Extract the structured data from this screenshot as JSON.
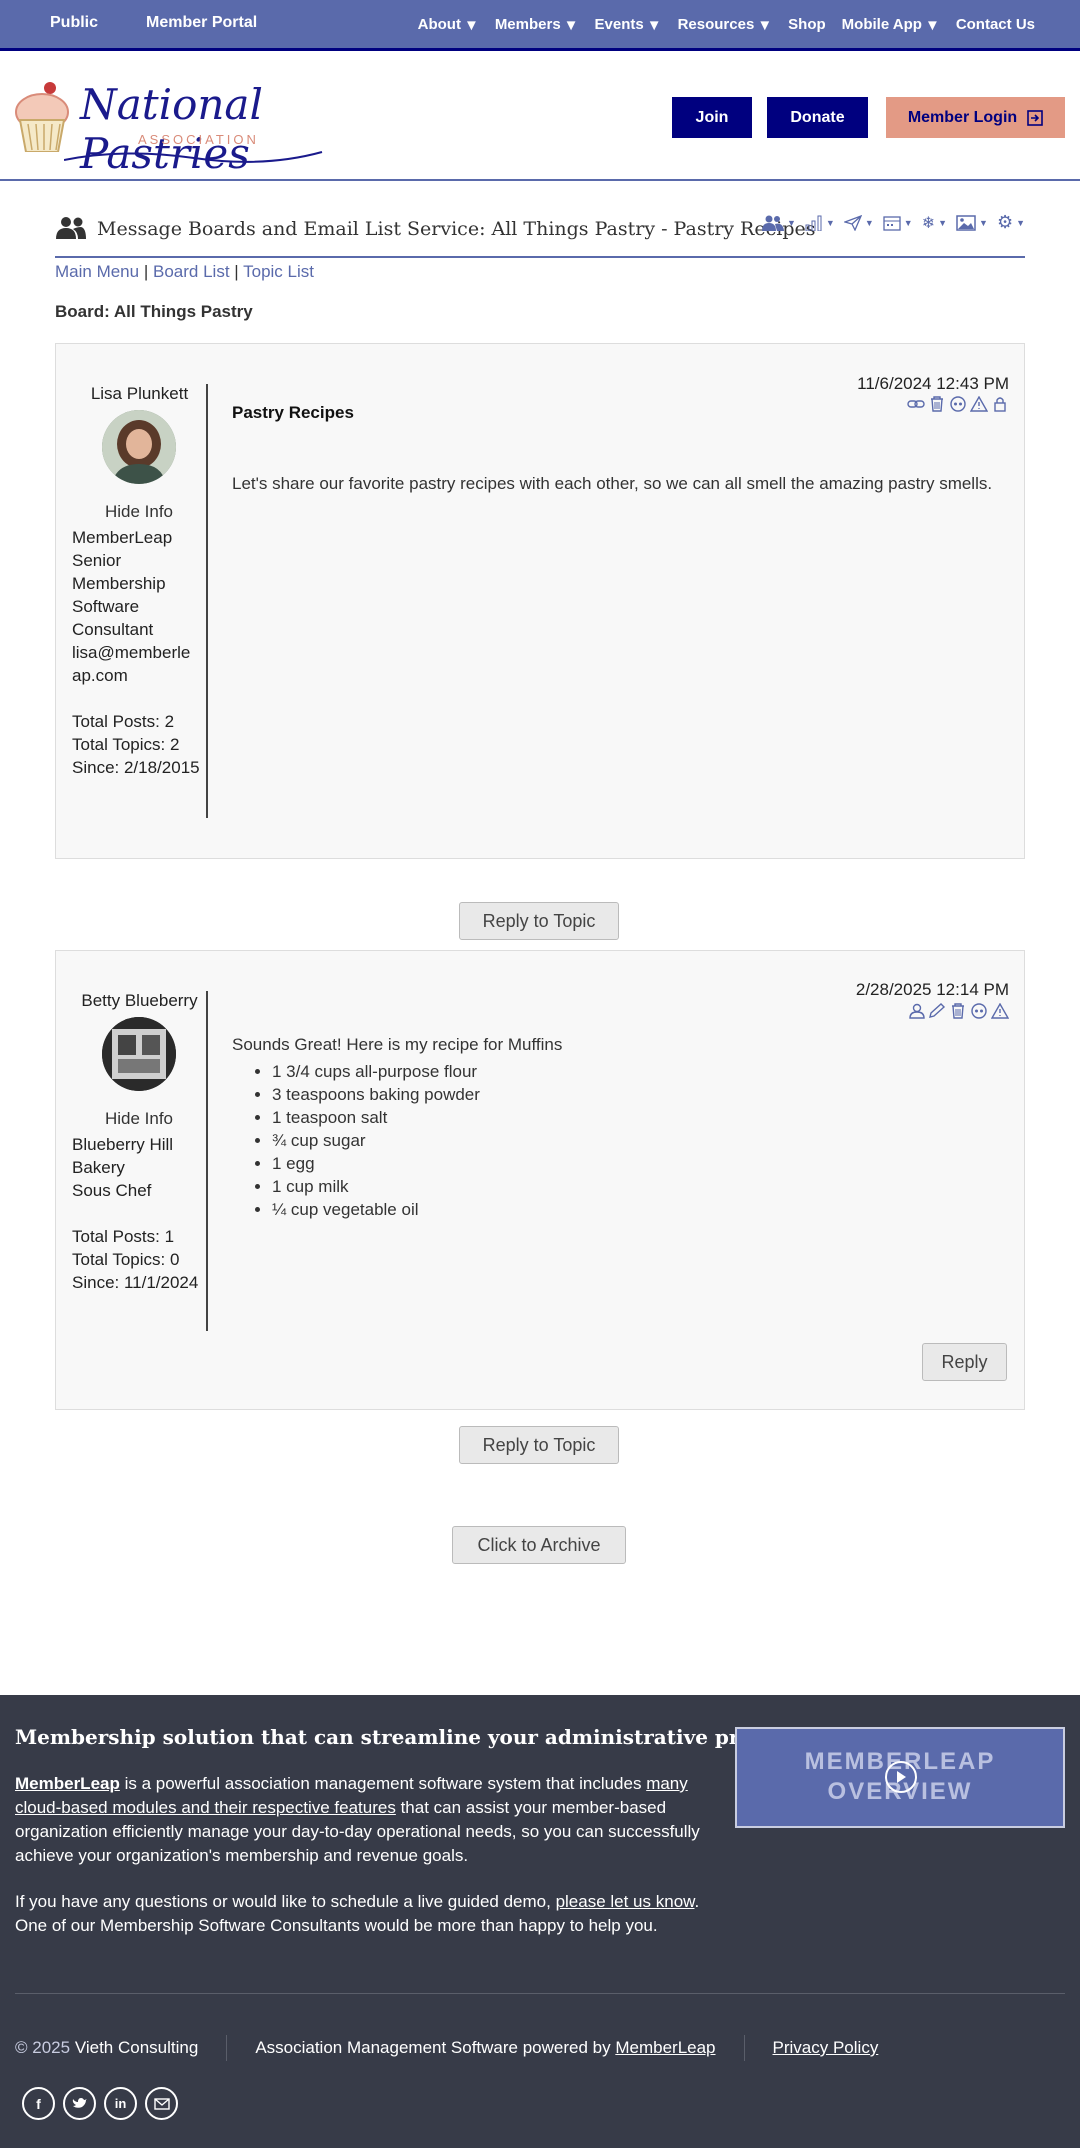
{
  "topnav": {
    "left": [
      "Public",
      "Member Portal"
    ],
    "right": [
      {
        "label": "About",
        "dropdown": true
      },
      {
        "label": "Members",
        "dropdown": true
      },
      {
        "label": "Events",
        "dropdown": true
      },
      {
        "label": "Resources",
        "dropdown": true
      },
      {
        "label": "Shop",
        "dropdown": false
      },
      {
        "label": "Mobile App",
        "dropdown": true
      },
      {
        "label": "Contact Us",
        "dropdown": false
      }
    ]
  },
  "header": {
    "logo_line1": "National Pastries",
    "logo_line2": "ASSOCIATION",
    "join": "Join",
    "donate": "Donate",
    "login": "Member Login"
  },
  "board": {
    "title": "Message Boards and Email List Service: All Things Pastry - Pastry Recipes",
    "breadcrumbs": [
      "Main Menu",
      "Board List",
      "Topic List"
    ],
    "board_label": "Board: All Things Pastry"
  },
  "posts": [
    {
      "author": "Lisa Plunkett",
      "hide_info": "Hide Info",
      "info": [
        "MemberLeap",
        "Senior",
        "Membership",
        "Software",
        "Consultant",
        "lisa@memberle",
        "ap.com"
      ],
      "stats": [
        "Total Posts: 2",
        "Total Topics: 2",
        "Since: 2/18/2015"
      ],
      "date": "11/6/2024 12:43 PM",
      "subject": "Pastry Recipes",
      "body": "Let's share our favorite pastry recipes with each other, so we can all smell the amazing pastry smells."
    },
    {
      "author": "Betty Blueberry",
      "hide_info": "Hide Info",
      "info": [
        "Blueberry Hill",
        "Bakery",
        "Sous Chef"
      ],
      "stats": [
        "Total Posts: 1",
        "Total Topics: 0",
        "Since: 11/1/2024"
      ],
      "date": "2/28/2025 12:14 PM",
      "body": "Sounds Great! Here is my recipe for Muffins",
      "list": [
        "1 3/4 cups all-purpose flour",
        "3 teaspoons baking powder",
        "1 teaspoon salt",
        "¾ cup sugar",
        "1 egg",
        "1 cup milk",
        "¼ cup vegetable oil"
      ],
      "reply": "Reply"
    }
  ],
  "buttons": {
    "reply_to_topic": "Reply to Topic",
    "archive": "Click to Archive"
  },
  "footer": {
    "heading": "Membership solution that can streamline your administrative processes",
    "p1_link1": "MemberLeap",
    "p1_text1": " is a powerful association management software system that includes ",
    "p1_link2": "many cloud-based modules and their respective features",
    "p1_text2": " that can assist your member-based organization efficiently manage your day-to-day operational needs, so you can successfully achieve your organization's membership and revenue goals.",
    "p2_text1": "If you have any questions or would like to schedule a live guided demo, ",
    "p2_link": "please let us know",
    "p2_text2": ". One of our Membership Software Consultants would be more than happy to help you.",
    "video_line1": "MEMBERLEAP",
    "video_line2": "OVERVIEW",
    "copyright": "© 2025",
    "company": "Vieth Consulting",
    "powered_text": "Association Management Software powered by ",
    "powered_link": "MemberLeap",
    "privacy": "Privacy Policy"
  },
  "social": [
    "f",
    "t",
    "in",
    "mail"
  ],
  "colors": {
    "nav": "#5a6aab",
    "brand_dark": "#00007f",
    "login": "#e39a85",
    "footer": "#373b48"
  }
}
